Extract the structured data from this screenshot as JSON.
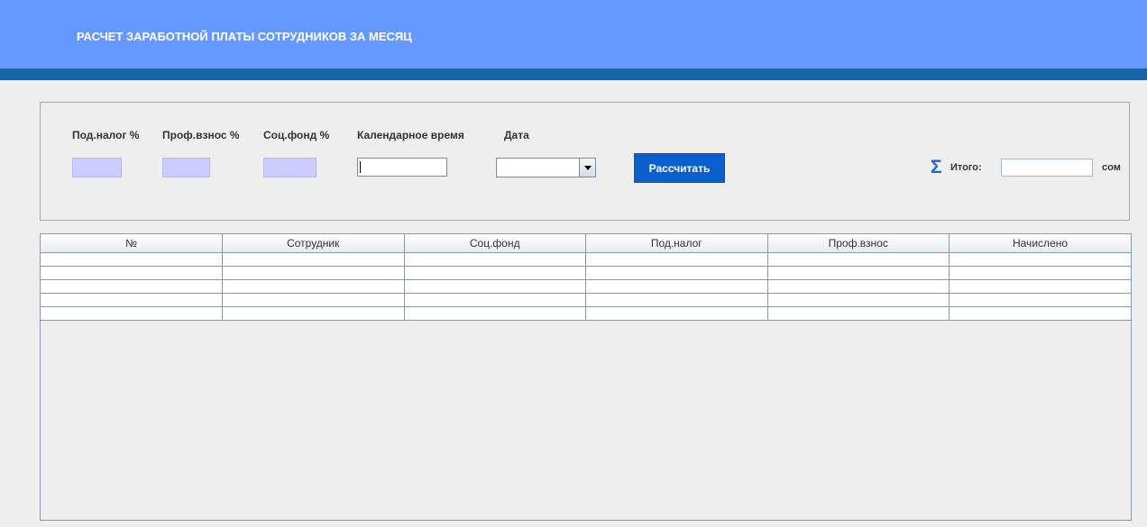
{
  "header": {
    "title": "РАСЧЕТ ЗАРАБОТНОЙ ПЛАТЫ СОТРУДНИКОВ ЗА МЕСЯЦ"
  },
  "form": {
    "income_tax_label": "Под.налог %",
    "income_tax_value": "",
    "prof_fee_label": "Проф.взнос %",
    "prof_fee_value": "",
    "social_fund_label": "Соц.фонд %",
    "social_fund_value": "",
    "calendar_time_label": "Календарное время",
    "calendar_time_value": "",
    "date_label": "Дата",
    "date_value": "",
    "calculate_label": "Рассчитать",
    "sigma_icon": "Σ",
    "total_label": "Итого:",
    "total_value": "",
    "currency": "сом"
  },
  "table": {
    "columns": [
      "№",
      "Сотрудник",
      "Соц.фонд",
      "Под.налог",
      "Проф.взнос",
      "Начислено"
    ],
    "rows": [
      [
        "",
        "",
        "",
        "",
        "",
        ""
      ],
      [
        "",
        "",
        "",
        "",
        "",
        ""
      ],
      [
        "",
        "",
        "",
        "",
        "",
        ""
      ],
      [
        "",
        "",
        "",
        "",
        "",
        ""
      ],
      [
        "",
        "",
        "",
        "",
        "",
        ""
      ]
    ]
  },
  "colors": {
    "header_bg": "#6699ff",
    "header_stripe": "#1a63a8",
    "button_bg": "#0a5fcc",
    "percent_field_bg": "#ccccff"
  }
}
